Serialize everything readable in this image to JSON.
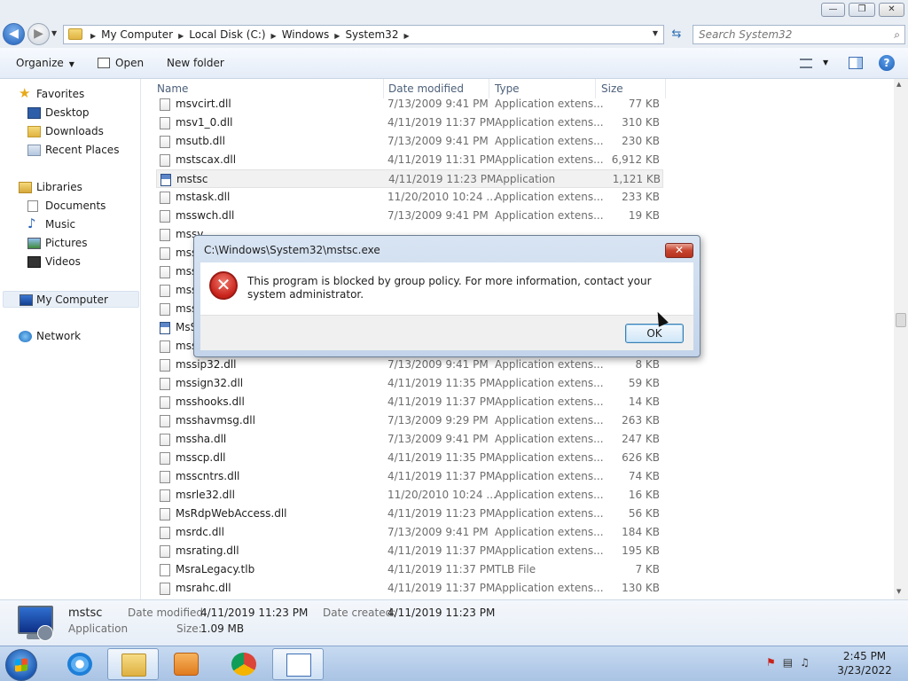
{
  "window": {
    "min_glyph": "—",
    "max_glyph": "❐",
    "close_glyph": "✕"
  },
  "address": {
    "crumbs": [
      "My Computer",
      "Local Disk (C:)",
      "Windows",
      "System32"
    ],
    "search_placeholder": "Search System32"
  },
  "toolbar": {
    "organize": "Organize",
    "open": "Open",
    "new_folder": "New folder"
  },
  "nav": {
    "favorites": "Favorites",
    "desktop": "Desktop",
    "downloads": "Downloads",
    "recent": "Recent Places",
    "libraries": "Libraries",
    "documents": "Documents",
    "music": "Music",
    "pictures": "Pictures",
    "videos": "Videos",
    "computer": "My Computer",
    "network": "Network"
  },
  "columns": {
    "name": "Name",
    "date": "Date modified",
    "type": "Type",
    "size": "Size"
  },
  "files": [
    {
      "name": "msvcirt.dll",
      "date": "7/13/2009 9:41 PM",
      "type": "Application extens...",
      "size": "77 KB",
      "icon": "dll"
    },
    {
      "name": "msv1_0.dll",
      "date": "4/11/2019 11:37 PM",
      "type": "Application extens...",
      "size": "310 KB",
      "icon": "dll"
    },
    {
      "name": "msutb.dll",
      "date": "7/13/2009 9:41 PM",
      "type": "Application extens...",
      "size": "230 KB",
      "icon": "dll"
    },
    {
      "name": "mstscax.dll",
      "date": "4/11/2019 11:31 PM",
      "type": "Application extens...",
      "size": "6,912 KB",
      "icon": "dll"
    },
    {
      "name": "mstsc",
      "date": "4/11/2019 11:23 PM",
      "type": "Application",
      "size": "1,121 KB",
      "icon": "app",
      "selected": true
    },
    {
      "name": "mstask.dll",
      "date": "11/20/2010 10:24 ...",
      "type": "Application extens...",
      "size": "233 KB",
      "icon": "dll"
    },
    {
      "name": "msswch.dll",
      "date": "7/13/2009 9:41 PM",
      "type": "Application extens...",
      "size": "19 KB",
      "icon": "dll"
    },
    {
      "name": "mssv",
      "date": "",
      "type": "",
      "size": "",
      "icon": "dll"
    },
    {
      "name": "mss",
      "date": "",
      "type": "",
      "size": "",
      "icon": "dll"
    },
    {
      "name": "mss",
      "date": "",
      "type": "",
      "size": "",
      "icon": "dll"
    },
    {
      "name": "mss",
      "date": "",
      "type": "",
      "size": "",
      "icon": "dll"
    },
    {
      "name": "mss",
      "date": "",
      "type": "",
      "size": "",
      "icon": "dll"
    },
    {
      "name": "MsS",
      "date": "",
      "type": "",
      "size": "",
      "icon": "app"
    },
    {
      "name": "mss",
      "date": "",
      "type": "",
      "size": "",
      "icon": "dll"
    },
    {
      "name": "mssip32.dll",
      "date": "7/13/2009 9:41 PM",
      "type": "Application extens...",
      "size": "8 KB",
      "icon": "dll"
    },
    {
      "name": "mssign32.dll",
      "date": "4/11/2019 11:35 PM",
      "type": "Application extens...",
      "size": "59 KB",
      "icon": "dll"
    },
    {
      "name": "msshooks.dll",
      "date": "4/11/2019 11:37 PM",
      "type": "Application extens...",
      "size": "14 KB",
      "icon": "dll"
    },
    {
      "name": "msshavmsg.dll",
      "date": "7/13/2009 9:29 PM",
      "type": "Application extens...",
      "size": "263 KB",
      "icon": "dll"
    },
    {
      "name": "mssha.dll",
      "date": "7/13/2009 9:41 PM",
      "type": "Application extens...",
      "size": "247 KB",
      "icon": "dll"
    },
    {
      "name": "msscp.dll",
      "date": "4/11/2019 11:35 PM",
      "type": "Application extens...",
      "size": "626 KB",
      "icon": "dll"
    },
    {
      "name": "msscntrs.dll",
      "date": "4/11/2019 11:37 PM",
      "type": "Application extens...",
      "size": "74 KB",
      "icon": "dll"
    },
    {
      "name": "msrle32.dll",
      "date": "11/20/2010 10:24 ...",
      "type": "Application extens...",
      "size": "16 KB",
      "icon": "dll"
    },
    {
      "name": "MsRdpWebAccess.dll",
      "date": "4/11/2019 11:23 PM",
      "type": "Application extens...",
      "size": "56 KB",
      "icon": "dll"
    },
    {
      "name": "msrdc.dll",
      "date": "7/13/2009 9:41 PM",
      "type": "Application extens...",
      "size": "184 KB",
      "icon": "dll"
    },
    {
      "name": "msrating.dll",
      "date": "4/11/2019 11:37 PM",
      "type": "Application extens...",
      "size": "195 KB",
      "icon": "dll"
    },
    {
      "name": "MsraLegacy.tlb",
      "date": "4/11/2019 11:37 PM",
      "type": "TLB File",
      "size": "7 KB",
      "icon": "plain"
    },
    {
      "name": "msrahc.dll",
      "date": "4/11/2019 11:37 PM",
      "type": "Application extens...",
      "size": "130 KB",
      "icon": "dll"
    }
  ],
  "details": {
    "name": "mstsc",
    "type": "Application",
    "modified_label": "Date modified:",
    "modified": "4/11/2019 11:23 PM",
    "created_label": "Date created:",
    "created": "4/11/2019 11:23 PM",
    "size_label": "Size:",
    "size": "1.09 MB"
  },
  "dialog": {
    "title": "C:\\Windows\\System32\\mstsc.exe",
    "message": "This program is blocked by group policy. For more information, contact your system administrator.",
    "ok": "OK",
    "icon": "error-icon"
  },
  "taskbar": {
    "time": "2:45 PM",
    "date": "3/23/2022"
  },
  "colors": {
    "accent": "#1f5fb9",
    "error": "#c8231b",
    "taskbar": "#b9d0ec"
  }
}
